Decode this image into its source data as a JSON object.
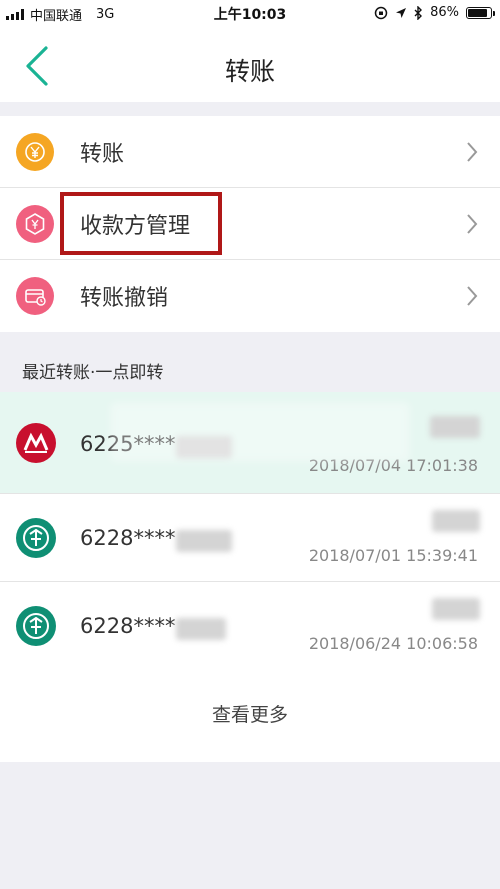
{
  "status_bar": {
    "carrier": "中国联通",
    "network": "3G",
    "time": "上午10:03",
    "battery": "86%",
    "battery_level": 0.86
  },
  "nav": {
    "title": "转账",
    "back_icon": "chevron-left-icon",
    "accent_color": "#1ab394"
  },
  "menu": {
    "items": [
      {
        "label": "转账",
        "icon": "yuan-transfer-icon",
        "color": "#f5a623"
      },
      {
        "label": "收款方管理",
        "icon": "payee-hexagon-icon",
        "color": "#f0607f"
      },
      {
        "label": "转账撤销",
        "icon": "card-revoke-icon",
        "color": "#f0607f"
      }
    ]
  },
  "recent": {
    "title": "最近转账·一点即转",
    "items": [
      {
        "card": "6225****",
        "time": "2018/07/04 17:01:38",
        "bank_icon": "cmb-bank-logo-icon",
        "color": "#c8102e"
      },
      {
        "card": "6228****",
        "time": "2018/07/01 15:39:41",
        "bank_icon": "abc-bank-logo-icon",
        "color": "#0f8f74"
      },
      {
        "card": "6228****",
        "time": "2018/06/24 10:06:58",
        "bank_icon": "abc-bank-logo-icon",
        "color": "#0f8f74"
      }
    ],
    "more_label": "查看更多"
  }
}
